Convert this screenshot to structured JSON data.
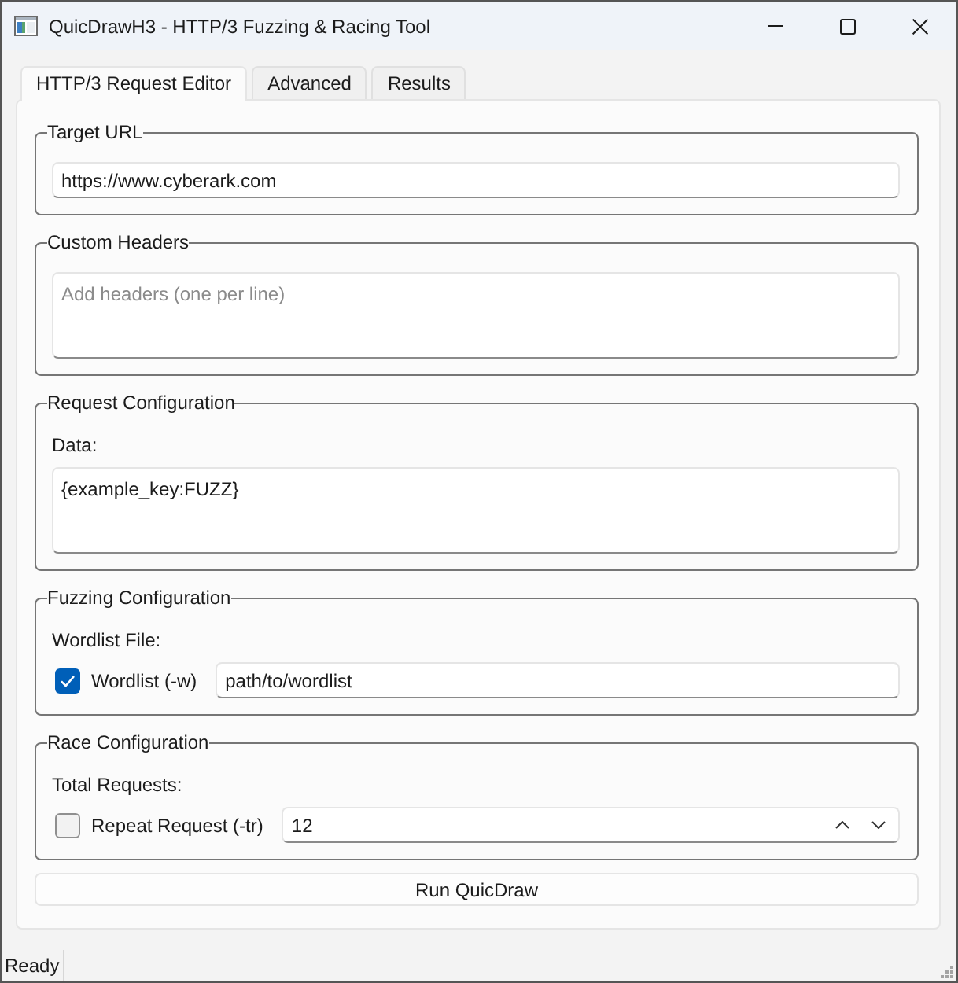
{
  "window": {
    "title": "QuicDrawH3 - HTTP/3 Fuzzing & Racing Tool"
  },
  "tabs": [
    {
      "label": "HTTP/3 Request Editor",
      "selected": true
    },
    {
      "label": "Advanced",
      "selected": false
    },
    {
      "label": "Results",
      "selected": false
    }
  ],
  "groups": [
    {
      "title": "Target URL",
      "items": [
        {
          "kind": "line_field",
          "value": "https://www.cyberark.com"
        }
      ]
    },
    {
      "title": "Custom Headers",
      "items": [
        {
          "kind": "text_area",
          "placeholder": "Add headers (one per line)"
        }
      ]
    },
    {
      "title": "Request Configuration",
      "items": [
        {
          "kind": "label",
          "text": "Data:"
        },
        {
          "kind": "text_area",
          "value": "{example_key:FUZZ}"
        }
      ]
    },
    {
      "title": "Fuzzing Configuration",
      "items": [
        {
          "kind": "label",
          "text": "Wordlist File:"
        },
        {
          "kind": "check_field",
          "label": "Wordlist (-w)",
          "checked": true,
          "value": "path/to/wordlist"
        }
      ]
    },
    {
      "title": "Race Configuration",
      "items": [
        {
          "kind": "label",
          "text": "Total Requests:"
        },
        {
          "kind": "check_spin",
          "label": "Repeat Request (-tr)",
          "checked": false,
          "value": "12"
        }
      ]
    }
  ],
  "run_button": {
    "label": "Run QuicDraw"
  },
  "status_bar": {
    "text": "Ready"
  }
}
